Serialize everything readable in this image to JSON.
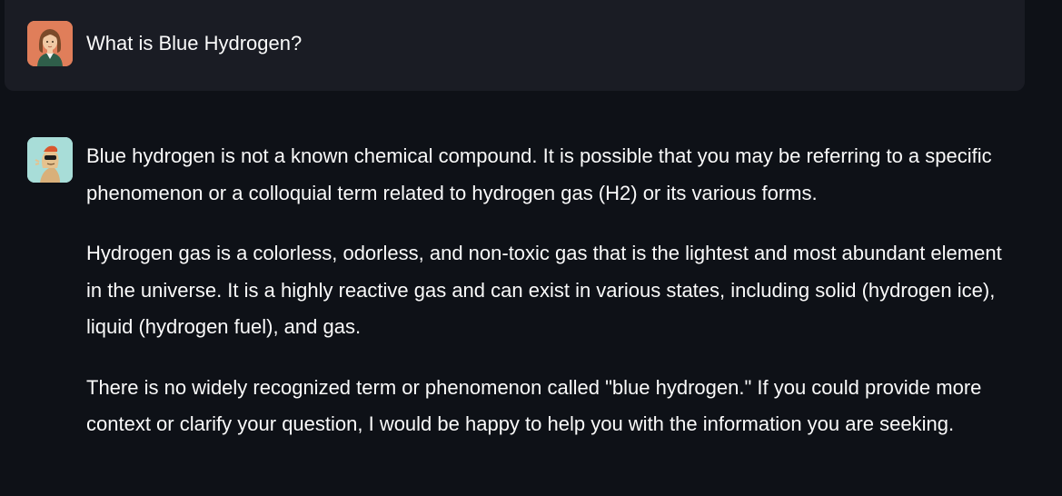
{
  "user_message": {
    "avatar_icon": "user-avatar-icon",
    "text": "What is Blue Hydrogen?"
  },
  "assistant_message": {
    "avatar_icon": "assistant-avatar-icon",
    "paragraphs": [
      "Blue hydrogen is not a known chemical compound. It is possible that you may be referring to a specific phenomenon or a colloquial term related to hydrogen gas (H2) or its various forms.",
      "Hydrogen gas is a colorless, odorless, and non-toxic gas that is the lightest and most abundant element in the universe. It is a highly reactive gas and can exist in various states, including solid (hydrogen ice), liquid (hydrogen fuel), and gas.",
      "There is no widely recognized term or phenomenon called \"blue hydrogen.\" If you could provide more context or clarify your question, I would be happy to help you with the information you are seeking."
    ]
  },
  "colors": {
    "background": "#0e1117",
    "user_bubble": "#1a1c24",
    "text": "#fafafa",
    "user_avatar_bg": "#e07e5a",
    "assistant_avatar_bg": "#a8ddd8"
  }
}
